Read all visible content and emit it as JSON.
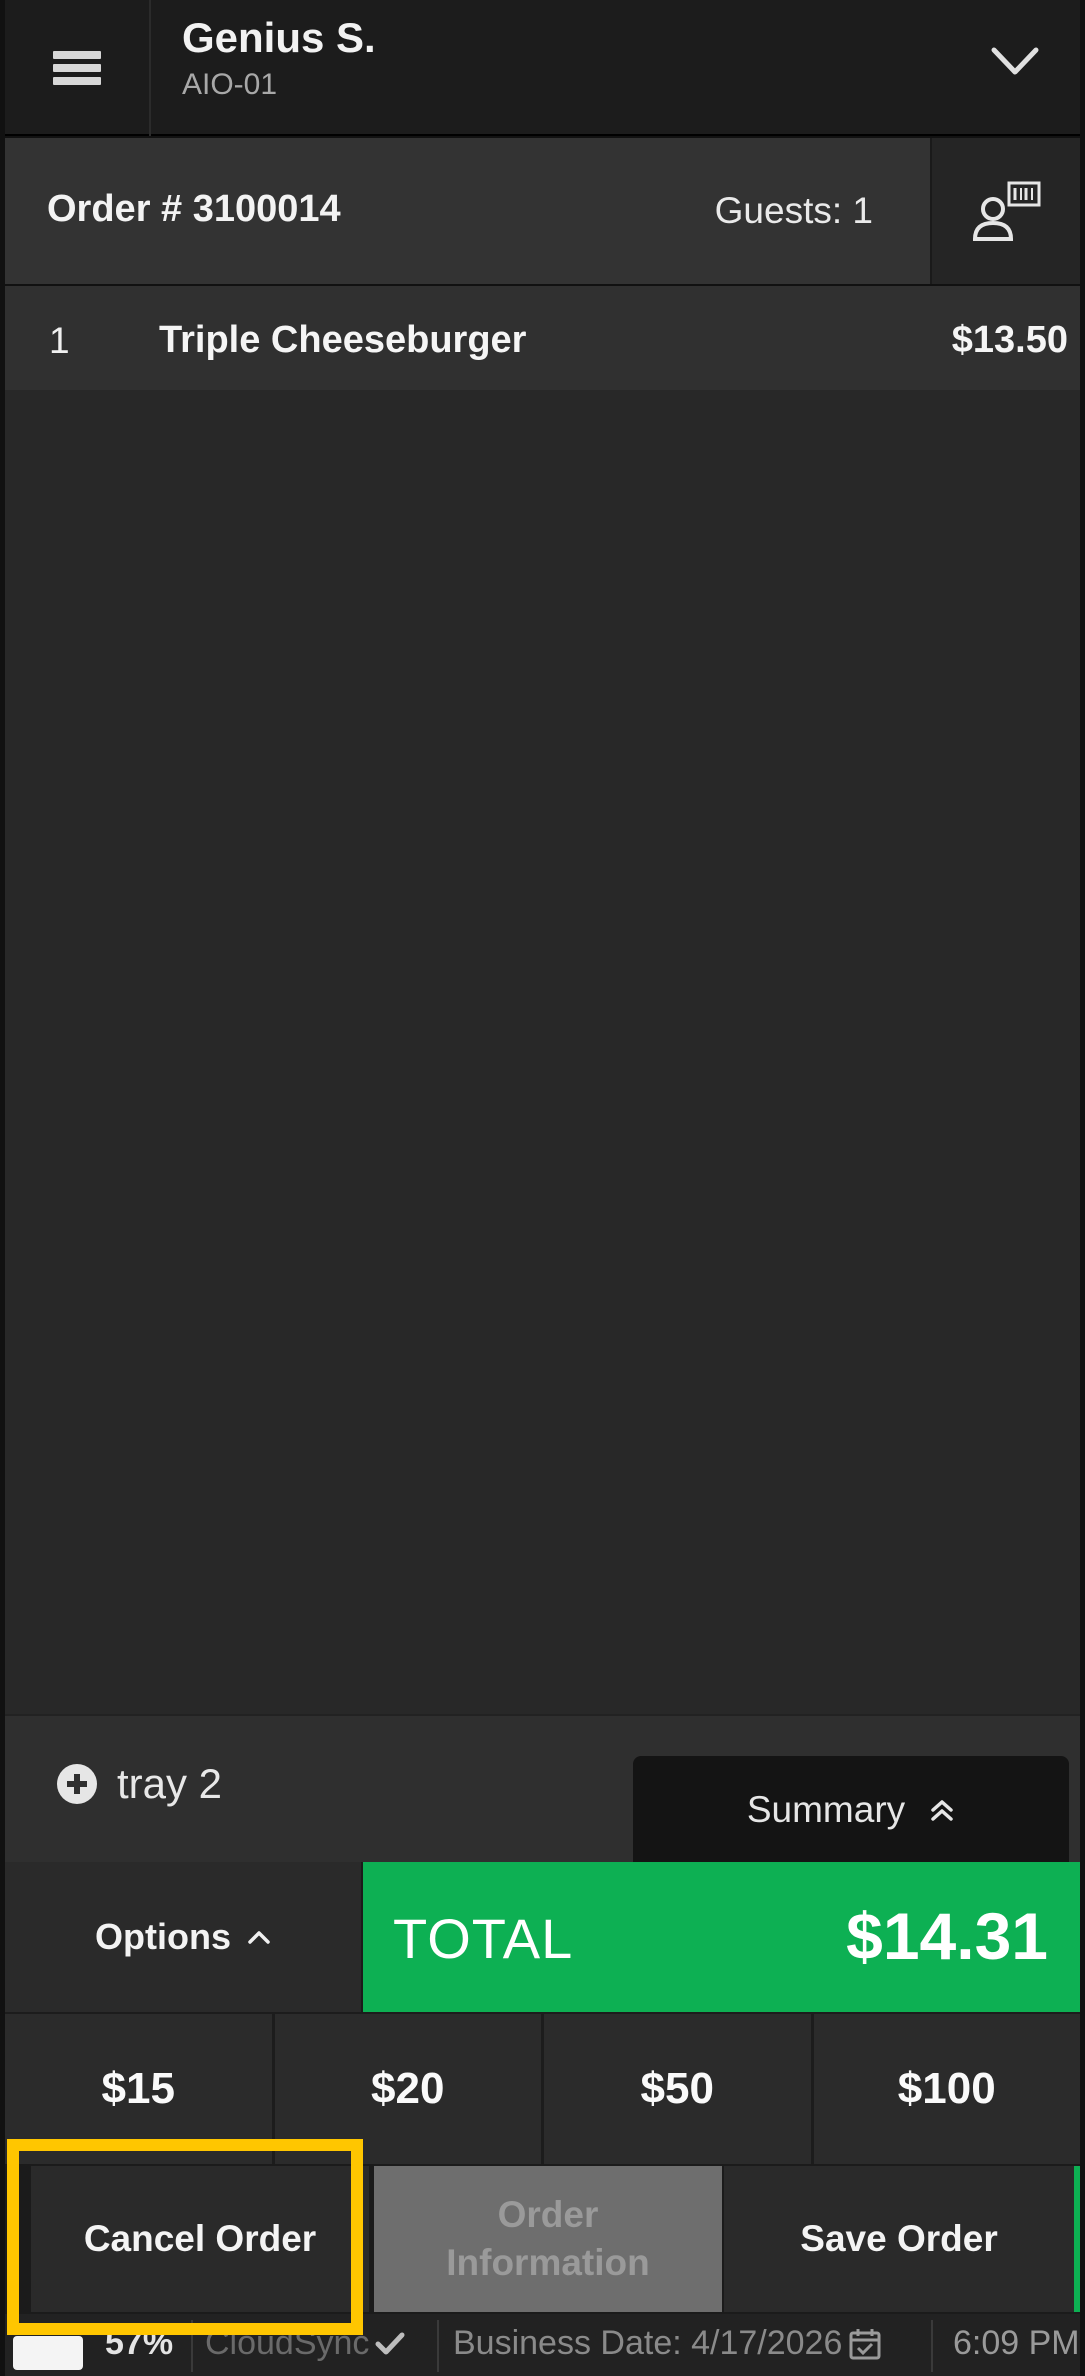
{
  "header": {
    "user_name": "Genius S.",
    "device_id": "AIO-01"
  },
  "order": {
    "number_label": "Order # 3100014",
    "guests_label": "Guests: 1"
  },
  "items": [
    {
      "qty": "1",
      "name": "Triple Cheeseburger",
      "price": "$13.50"
    }
  ],
  "tray": {
    "label": "tray 2"
  },
  "summary": {
    "label": "Summary"
  },
  "options": {
    "label": "Options"
  },
  "total": {
    "label": "TOTAL",
    "value": "$14.31"
  },
  "quick_cash": [
    "$15",
    "$20",
    "$50",
    "$100"
  ],
  "actions": {
    "cancel": "Cancel Order",
    "info_line1": "Order",
    "info_line2": "Information",
    "save": "Save Order"
  },
  "status": {
    "battery": "57%",
    "cloud": "CloudSync",
    "business_date": "Business Date: 4/17/2026",
    "time": "6:09 PM"
  },
  "colors": {
    "total_green": "#0db053",
    "highlight": "#ffc600"
  },
  "icons": [
    "hamburger-menu-icon",
    "chevron-down-icon",
    "guest-scan-icon",
    "add-circle-icon",
    "double-chevron-up-icon",
    "chevron-up-icon",
    "check-icon",
    "calendar-icon"
  ]
}
